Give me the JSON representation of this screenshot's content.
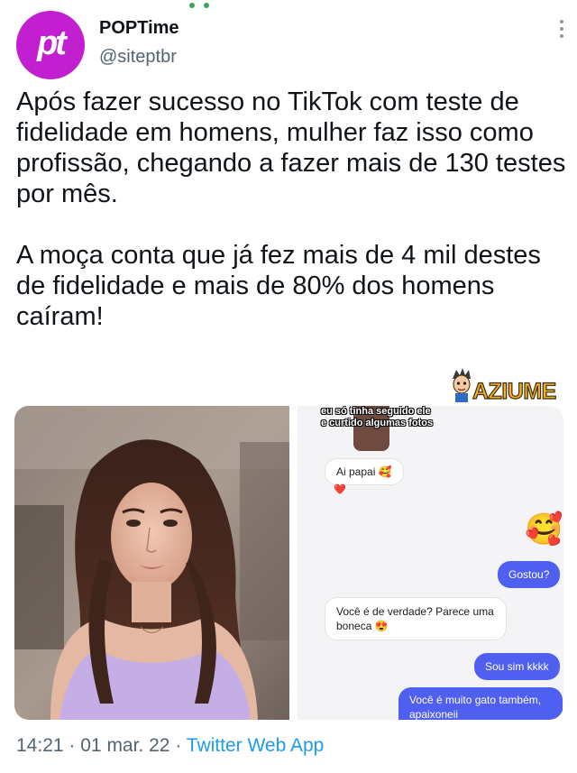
{
  "tweet": {
    "avatar_text": "pt",
    "display_name": "POPTime",
    "handle": "@siteptbr",
    "paragraphs": [
      "Após fazer sucesso no TikTok com teste de fidelidade em homens, mulher faz isso como profissão, chegando a fazer mais de 130 testes por mês.",
      "A moça conta que já fez mais de 4 mil destes de fidelidade e mais de 80% dos homens caíram!"
    ],
    "time": "14:21",
    "date": "01 mar. 22",
    "source": "Twitter Web App",
    "separator": "·"
  },
  "watermark": {
    "text": "AZIUME"
  },
  "chat": {
    "caption_lines": [
      "eu só tinha seguido ele",
      "e curtido algumas fotos"
    ],
    "messages": [
      {
        "side": "in",
        "text": "Ai papai 🥰",
        "reaction": "❤️"
      },
      {
        "side": "out",
        "emoji": "🥰"
      },
      {
        "side": "out",
        "text": "Gostou?"
      },
      {
        "side": "in",
        "text": "Você é de verdade? Parece uma boneca 😍"
      },
      {
        "side": "out",
        "text": "Sou sim kkkk"
      },
      {
        "side": "out",
        "text": "Você é muito gato também, apaixoneii"
      }
    ]
  },
  "colors": {
    "avatar": "#c21fd0",
    "link": "#1d9bf0",
    "muted": "#536471",
    "chat_out": "#4f5ff0"
  }
}
